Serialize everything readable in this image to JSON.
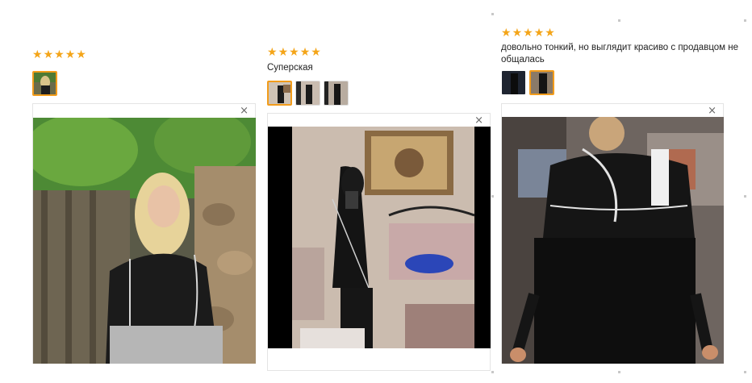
{
  "reviews": [
    {
      "rating": 5,
      "text": "",
      "close_icon": "×"
    },
    {
      "rating": 5,
      "text": "Суперская",
      "close_icon": "×"
    },
    {
      "rating": 5,
      "text": "довольно тонкий, но выглядит красиво с продавцом не общалась",
      "close_icon": "×"
    }
  ],
  "star_glyph": "★",
  "colors": {
    "star": "#f4a519",
    "active_border": "#f29c1b"
  }
}
